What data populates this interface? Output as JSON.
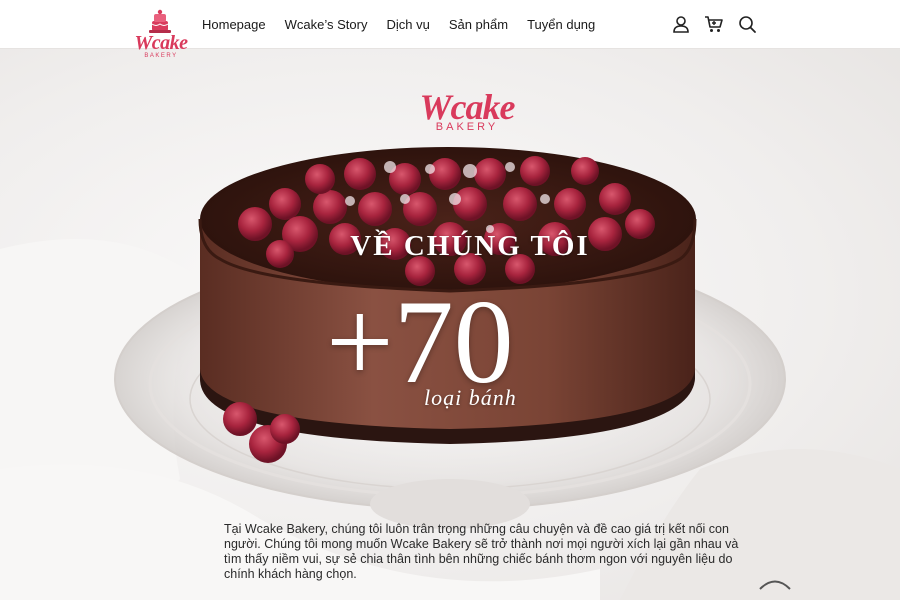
{
  "header": {
    "logo_text": "Wcake",
    "logo_sub": "BAKERY",
    "nav": [
      {
        "label": "Homepage"
      },
      {
        "label": "Wcake’s Story"
      },
      {
        "label": "Dịch vụ"
      },
      {
        "label": "Sản phẩm"
      },
      {
        "label": "Tuyển dụng"
      }
    ],
    "icons": [
      "user-icon",
      "cart-icon",
      "search-icon"
    ]
  },
  "hero": {
    "logo_text": "Wcake",
    "logo_sub": "BAKERY",
    "title": "VỀ CHÚNG TÔI",
    "stat_number": "+70",
    "stat_label": "loại bánh",
    "description": "Tại Wcake Bakery, chúng tôi luôn trân trọng những câu chuyện và đề cao giá trị kết nối con người. Chúng tôi mong muốn Wcake Bakery sẽ trở thành nơi mọi người xích lại gần nhau và tìm thấy niềm vui, sự sẻ chia thân tình bên những chiếc bánh thơm ngon với nguyên liệu do chính khách hàng chọn."
  },
  "colors": {
    "brand": "#d93a5c",
    "header_bg": "#ffffff",
    "hero_text": "#ffffff",
    "body_text": "#2a2a2a"
  }
}
